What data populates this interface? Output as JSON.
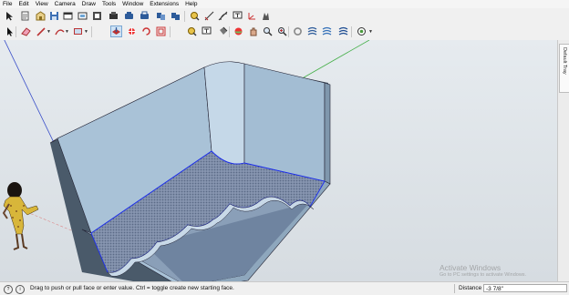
{
  "menu": [
    "File",
    "Edit",
    "View",
    "Camera",
    "Draw",
    "Tools",
    "Window",
    "Extensions",
    "Help"
  ],
  "toolbar_top": [
    {
      "name": "select-icon"
    },
    {
      "name": "new-icon"
    },
    {
      "name": "open-icon"
    },
    {
      "name": "save-icon"
    },
    {
      "name": "cut-icon"
    },
    {
      "name": "copy-icon"
    },
    {
      "name": "paste-icon"
    },
    {
      "name": "erase-icon"
    },
    {
      "name": "undo-icon"
    },
    {
      "name": "redo-icon"
    },
    {
      "name": "print-icon"
    },
    {
      "name": "model-info-icon"
    },
    {
      "name": "tape-measure-icon"
    },
    {
      "name": "dimension-icon"
    },
    {
      "name": "protractor-icon"
    },
    {
      "name": "text-icon"
    },
    {
      "name": "axes-icon"
    },
    {
      "name": "3d-text-icon"
    }
  ],
  "toolbar_main": [
    {
      "name": "select-arrow-icon"
    },
    {
      "name": "eraser-icon"
    },
    {
      "name": "pencil-line-icon"
    },
    {
      "name": "arc-icon"
    },
    {
      "name": "rectangle-icon"
    },
    {
      "name": "push-pull-icon",
      "active": true
    },
    {
      "name": "move-icon"
    },
    {
      "name": "rotate-icon"
    },
    {
      "name": "offset-icon"
    },
    {
      "name": "tape-icon"
    },
    {
      "name": "text-label-icon"
    },
    {
      "name": "paint-bucket-icon"
    },
    {
      "name": "orbit-icon"
    },
    {
      "name": "pan-icon"
    },
    {
      "name": "zoom-icon"
    },
    {
      "name": "zoom-extents-icon"
    },
    {
      "name": "get-models-icon"
    },
    {
      "name": "warehouse-icon"
    },
    {
      "name": "share-model-icon"
    },
    {
      "name": "extension-warehouse-icon"
    },
    {
      "name": "layout-icon"
    }
  ],
  "tray": {
    "label": "Default Tray"
  },
  "status": {
    "message": "Drag to push or pull face or enter value.  Ctrl = toggle create new starting face.",
    "distance_label": "Distance",
    "distance_value": "-3 7/8\""
  },
  "watermark": {
    "title": "Activate Windows",
    "subtitle": "Go to PC settings to activate Windows."
  },
  "colors": {
    "sky": "#dfe6ec",
    "ground": "#c9ccce",
    "wall_face": "#a9c3d7",
    "floor_pattern": "#7e8ea9",
    "selection": "#1a2cf0",
    "axis_green": "#47b04b",
    "axis_red": "#d33",
    "axis_blue": "#3a4fc9"
  }
}
